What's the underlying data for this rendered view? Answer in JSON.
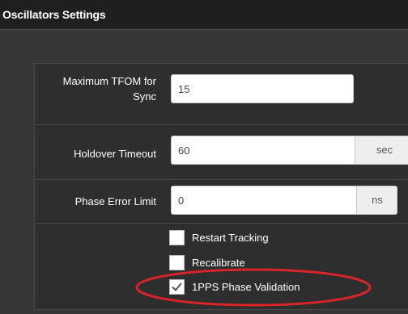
{
  "window": {
    "title": "Oscillators Settings"
  },
  "form": {
    "max_tfom": {
      "label": "Maximum TFOM for Sync",
      "value": "15"
    },
    "holdover_timeout": {
      "label": "Holdover Timeout",
      "value": "60",
      "unit": "sec"
    },
    "phase_error_limit": {
      "label": "Phase Error Limit",
      "value": "0",
      "unit": "ns"
    },
    "options": [
      {
        "label": "Restart Tracking",
        "checked": false
      },
      {
        "label": "Recalibrate",
        "checked": false
      },
      {
        "label": "1PPS Phase Validation",
        "checked": true
      }
    ]
  },
  "icons": {
    "checkmark": "check-icon"
  },
  "colors": {
    "title_bar": "#1f1f1f",
    "panel_bg": "#2e2e2e",
    "annotation": "#d9242a"
  }
}
